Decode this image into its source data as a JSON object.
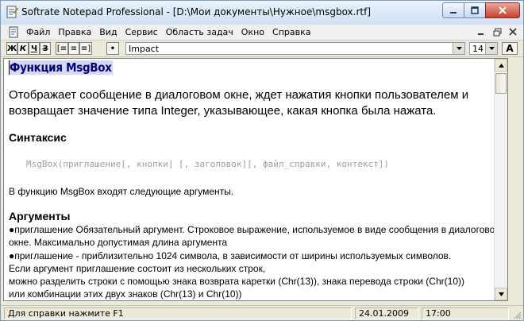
{
  "window": {
    "title": "Softrate Notepad Professional - [D:\\Мои документы\\Нужное\\msgbox.rtf]"
  },
  "menu": {
    "items": [
      "Файл",
      "Правка",
      "Вид",
      "Сервис",
      "Область задач",
      "Окно",
      "Справка"
    ]
  },
  "toolbar": {
    "bold": "Ж",
    "italic": "К",
    "underline": "Ч",
    "strike": "З",
    "align_left": "[≡",
    "align_center": "≡",
    "align_right": "≡]",
    "bullet": "•",
    "font_name": "Impact",
    "font_size": "14",
    "font_button": "A"
  },
  "document": {
    "heading": "Функция MsgBox",
    "lead": "Отображает сообщение в диалоговом окне, ждет нажатия кнопки пользователем и возвращает значение типа Integer, указывающее, какая кнопка была нажата.",
    "syntax_heading": "Синтаксис",
    "syntax": "MsgBox(приглашение[, кнопки] [, заголовок][, файл_справки, контекст])",
    "args_intro": "В функцию MsgBox входят следующие аргументы.",
    "args_heading": "Аргументы",
    "arg1": "приглашение Обязательный аргумент. Строковое выражение, используемое в виде сообщения в диалоговом окне. Максимально допустимая длина аргумента",
    "arg2": "приглашение - приблизительно 1024 символа, в зависимости от ширины используемых символов.",
    "line3": "Если аргумент приглашение состоит из нескольких строк,",
    "line4": "можно разделить строки с помощью знака возврата каретки (Chr(13)), знака перевода строки (Chr(10))",
    "line5": "или комбинации этих двух знаков (Chr(13) и Chr(10))"
  },
  "status": {
    "hint": "Для справки нажмите F1",
    "date": "24.01.2009",
    "time": "17:00"
  },
  "colors": {
    "heading": "#00007f",
    "heading_bg": "#d6d8f5",
    "syntax": "#9e9e9e"
  }
}
